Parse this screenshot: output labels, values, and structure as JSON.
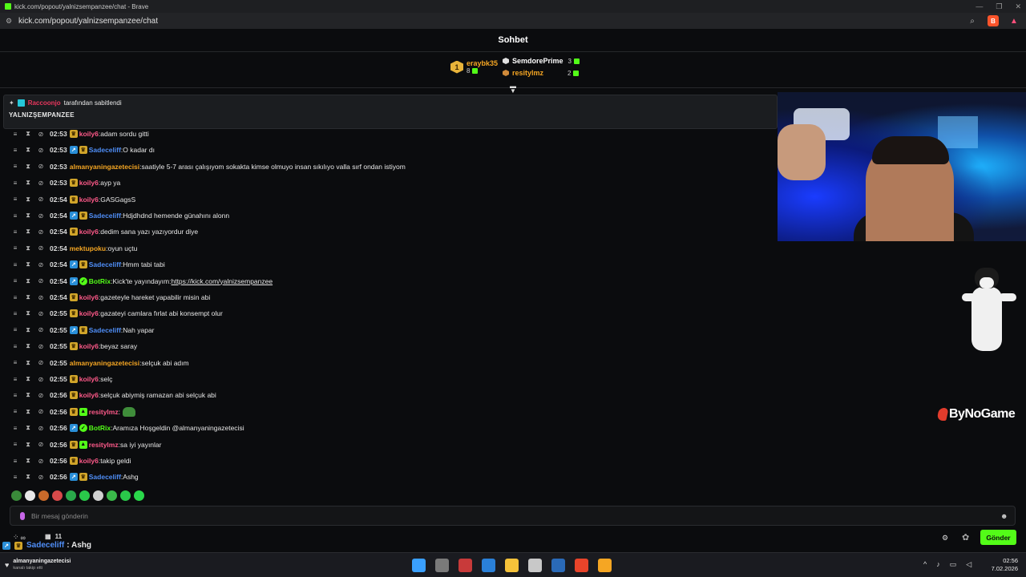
{
  "browser": {
    "window_title": "kick.com/popout/yalnizsempanzee/chat - Brave",
    "url": "kick.com/popout/yalnizsempanzee/chat",
    "window_controls": [
      "—",
      "❐",
      "✕"
    ]
  },
  "chat": {
    "header_title": "Sohbet",
    "leaderboard": {
      "first": {
        "rank": "1",
        "name": "eraybk35",
        "count": "8",
        "color": "#f5a623"
      },
      "second": {
        "name": "SemdorePrime",
        "count": "3",
        "color": "#ffffff"
      },
      "third": {
        "name": "resitylmz",
        "count": "2",
        "color": "#f5a623"
      }
    },
    "pinned": {
      "by_user": "Raccoonjo",
      "by_label": "tarafından sabitlendi",
      "text": "YALNIZŞEMPANZEE"
    },
    "messages": [
      {
        "time": "02:53",
        "user": "koily6",
        "color": "#ff5a8a",
        "badges": [
          "crown"
        ],
        "text": "adam sordu gitti"
      },
      {
        "time": "02:53",
        "user": "Sadeceliff",
        "color": "#4f8ef7",
        "badges": [
          "vip",
          "crown"
        ],
        "text": "O kadar dı"
      },
      {
        "time": "02:53",
        "user": "almanyaningazetecisi",
        "color": "#f5a623",
        "badges": [],
        "text": "saatiyle 5-7 arası çalışıyom sokakta kimse olmuyo insan sıkılıyo valla sırf ondan istiyom"
      },
      {
        "time": "02:53",
        "user": "koily6",
        "color": "#ff5a8a",
        "badges": [
          "crown"
        ],
        "text": "ayp ya"
      },
      {
        "time": "02:54",
        "user": "koily6",
        "color": "#ff5a8a",
        "badges": [
          "crown"
        ],
        "text": "GASGagsS"
      },
      {
        "time": "02:54",
        "user": "Sadeceliff",
        "color": "#4f8ef7",
        "badges": [
          "vip",
          "crown"
        ],
        "text": "Hdjdhdnd hemende günahını alonn"
      },
      {
        "time": "02:54",
        "user": "koily6",
        "color": "#ff5a8a",
        "badges": [
          "crown"
        ],
        "text": "dedim sana yazı yazıyordur diye"
      },
      {
        "time": "02:54",
        "user": "mektupoku",
        "color": "#f5a623",
        "badges": [],
        "text": "oyun uçtu"
      },
      {
        "time": "02:54",
        "user": "Sadeceliff",
        "color": "#4f8ef7",
        "badges": [
          "vip",
          "crown"
        ],
        "text": "Hmm tabi tabi"
      },
      {
        "time": "02:54",
        "user": "BotRix",
        "color": "#53fc18",
        "badges": [
          "vip",
          "bot"
        ],
        "text": "Kick'te yayındayım: ",
        "link": "https://kick.com/yalnizsempanzee"
      },
      {
        "time": "02:54",
        "user": "koily6",
        "color": "#ff5a8a",
        "badges": [
          "crown"
        ],
        "text": "gazeteyle hareket yapabilir misin abi"
      },
      {
        "time": "02:55",
        "user": "koily6",
        "color": "#ff5a8a",
        "badges": [
          "crown"
        ],
        "text": "gazateyi camlara fırlat abi konsempt olur"
      },
      {
        "time": "02:55",
        "user": "Sadeceliff",
        "color": "#4f8ef7",
        "badges": [
          "vip",
          "crown"
        ],
        "text": "Nah yapar"
      },
      {
        "time": "02:55",
        "user": "koily6",
        "color": "#ff5a8a",
        "badges": [
          "crown"
        ],
        "text": "beyaz saray"
      },
      {
        "time": "02:55",
        "user": "almanyaningazetecisi",
        "color": "#f5a623",
        "badges": [],
        "text": "selçuk abi adım"
      },
      {
        "time": "02:55",
        "user": "koily6",
        "color": "#ff5a8a",
        "badges": [
          "crown"
        ],
        "text": "selç"
      },
      {
        "time": "02:56",
        "user": "koily6",
        "color": "#ff5a8a",
        "badges": [
          "crown"
        ],
        "text": "selçuk abiymiş ramazan abi selçuk abi"
      },
      {
        "time": "02:56",
        "user": "resitylmz",
        "color": "#ff5a8a",
        "badges": [
          "crown",
          "sub"
        ],
        "text": "",
        "emote": true
      },
      {
        "time": "02:56",
        "user": "BotRix",
        "color": "#53fc18",
        "badges": [
          "vip",
          "bot"
        ],
        "text": "Aramıza Hoşgeldin @almanyaningazetecisi"
      },
      {
        "time": "02:56",
        "user": "resitylmz",
        "color": "#ff5a8a",
        "badges": [
          "crown",
          "sub"
        ],
        "text": "sa iyi yayınlar"
      },
      {
        "time": "02:56",
        "user": "koily6",
        "color": "#ff5a8a",
        "badges": [
          "crown"
        ],
        "text": "takip geldi"
      },
      {
        "time": "02:56",
        "user": "Sadeceliff",
        "color": "#4f8ef7",
        "badges": [
          "vip",
          "crown"
        ],
        "text": "Ashg"
      }
    ],
    "emote_bar": [
      "#3a8a3a",
      "#e8e8e8",
      "#c86a2a",
      "#d84a4a",
      "#2aa84a",
      "#2ac84a",
      "#d0d0d0",
      "#3ab84a",
      "#2ac84a",
      "#2ad84a"
    ],
    "input_placeholder": "Bir mesaj gönderin",
    "send_label": "Gönder",
    "viewer_count": "11",
    "infinity_label": "∞"
  },
  "overlay": {
    "last_user": "Sadeceliff",
    "last_text": ": Ashg",
    "watermark": "ByNoGame"
  },
  "taskbar": {
    "notification_name": "almanyaningazetecisi",
    "notification_sub": "kanalı takip etti",
    "icons": [
      "#3aa0ff",
      "#7a7a7a",
      "#c83a3a",
      "#2a80d8",
      "#f5c23a",
      "#c8c8c8",
      "#2a6ab8",
      "#e8442a",
      "#f5a623"
    ],
    "time": "02:56",
    "date": "7.02.2026"
  }
}
